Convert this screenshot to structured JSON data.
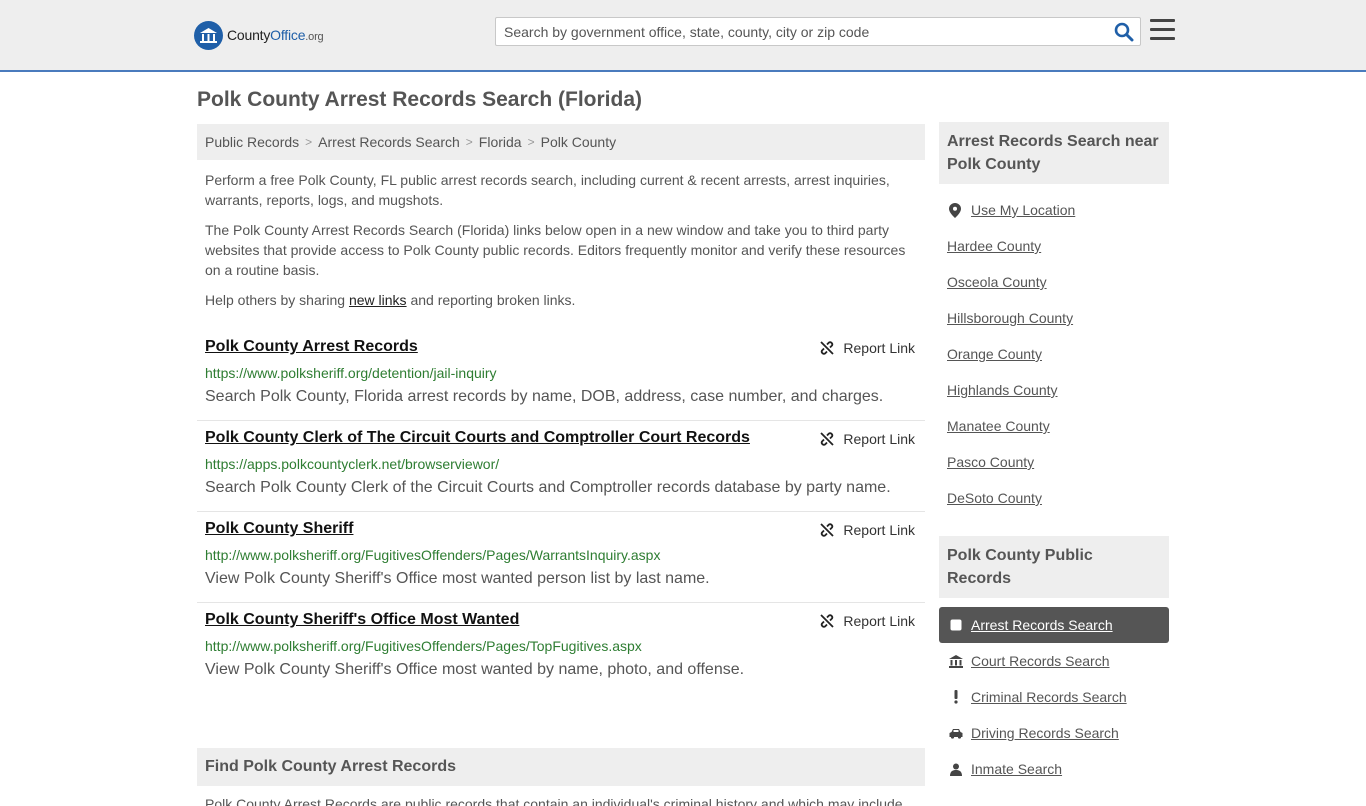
{
  "header": {
    "logo": {
      "brand": "County",
      "brand_accent": "Office",
      "tld": ".org"
    },
    "search": {
      "placeholder": "Search by government office, state, county, city or zip code"
    },
    "icons": {
      "search": "search-icon",
      "menu": "hamburger-menu-icon"
    }
  },
  "page": {
    "title": "Polk County Arrest Records Search (Florida)"
  },
  "breadcrumb": [
    "Public Records",
    "Arrest Records Search",
    "Florida",
    "Polk County"
  ],
  "intro": {
    "p1": "Perform a free Polk County, FL public arrest records search, including current & recent arrests, arrest inquiries, warrants, reports, logs, and mugshots.",
    "p2": "The Polk County Arrest Records Search (Florida) links below open in a new window and take you to third party websites that provide access to Polk County public records. Editors frequently monitor and verify these resources on a routine basis.",
    "p3_before": "Help others by sharing ",
    "p3_link": "new links",
    "p3_after": " and reporting broken links."
  },
  "results": [
    {
      "title": "Polk County Arrest Records",
      "url": "https://www.polksheriff.org/detention/jail-inquiry",
      "desc": "Search Polk County, Florida arrest records by name, DOB, address, case number, and charges.",
      "report": "Report Link"
    },
    {
      "title": "Polk County Clerk of The Circuit Courts and Comptroller Court Records",
      "url": "https://apps.polkcountyclerk.net/browserviewor/",
      "desc": "Search Polk County Clerk of the Circuit Courts and Comptroller records database by party name.",
      "report": "Report Link"
    },
    {
      "title": "Polk County Sheriff",
      "url": "http://www.polksheriff.org/FugitivesOffenders/Pages/WarrantsInquiry.aspx",
      "desc": "View Polk County Sheriff's Office most wanted person list by last name.",
      "report": "Report Link"
    },
    {
      "title": "Polk County Sheriff's Office Most Wanted",
      "url": "http://www.polksheriff.org/FugitivesOffenders/Pages/TopFugitives.aspx",
      "desc": "View Polk County Sheriff's Office most wanted by name, photo, and offense.",
      "report": "Report Link"
    }
  ],
  "find_section": {
    "title": "Find Polk County Arrest Records",
    "text": "Polk County Arrest Records are public records that contain an individual's criminal history and which may include"
  },
  "sidebar": {
    "nearby_title": "Arrest Records Search near Polk County",
    "use_location": "Use My Location",
    "counties": [
      "Hardee County",
      "Osceola County",
      "Hillsborough County",
      "Orange County",
      "Highlands County",
      "Manatee County",
      "Pasco County",
      "DeSoto County"
    ],
    "public_records_title": "Polk County Public Records",
    "categories": [
      {
        "label": "Arrest Records Search",
        "icon": "checkbox-icon",
        "active": true
      },
      {
        "label": "Court Records Search",
        "icon": "courthouse-icon",
        "active": false
      },
      {
        "label": "Criminal Records Search",
        "icon": "exclamation-icon",
        "active": false
      },
      {
        "label": "Driving Records Search",
        "icon": "car-icon",
        "active": false
      },
      {
        "label": "Inmate Search",
        "icon": "inmate-icon",
        "active": false
      }
    ]
  },
  "colors": {
    "header_bg": "#eeeeee",
    "header_border": "#4a7bbd",
    "url_green": "#2e7d32",
    "active_bg": "#555555",
    "brand_blue": "#1f5fa8"
  }
}
